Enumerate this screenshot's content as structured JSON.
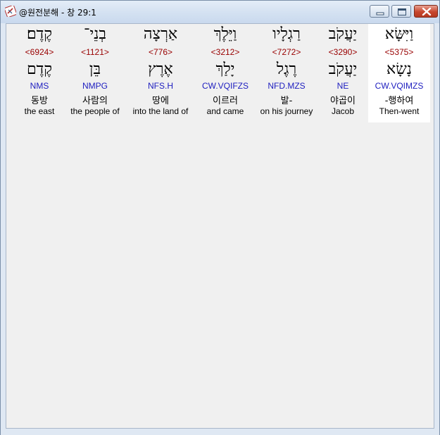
{
  "window": {
    "title": "@원전분해 - 창 29:1",
    "icon": "app-icon"
  },
  "words": [
    {
      "lemma_form": "וַיִּשָּׂא",
      "strong": "<5375>",
      "root": "נָשָׂא",
      "morph": "CW.VQIMZS",
      "korean": "-행하여",
      "english": "Then-went",
      "selected": true
    },
    {
      "lemma_form": "יַעֲקֹב",
      "strong": "<3290>",
      "root": "יַעֲקֹב",
      "morph": "NE",
      "korean": "야곱이",
      "english": "Jacob",
      "selected": false
    },
    {
      "lemma_form": "רַגְלָיו",
      "strong": "<7272>",
      "root": "רֶגֶל",
      "morph": "NFD.MZS",
      "korean": "발-",
      "english": "on his journey",
      "selected": false
    },
    {
      "lemma_form": "וַיֵּלֶךְ",
      "strong": "<3212>",
      "root": "יָלַךְ",
      "morph": "CW.VQIFZS",
      "korean": "이르러",
      "english": "and came",
      "selected": false
    },
    {
      "lemma_form": "אַרְצָה",
      "strong": "<776>",
      "root": "אֶרֶץ",
      "morph": "NFS.H",
      "korean": "땅에",
      "english": "into the land of",
      "selected": false
    },
    {
      "lemma_form": "בְנֵי־",
      "strong": "<1121>",
      "root": "בֵּן",
      "morph": "NMPG",
      "korean": "사람의",
      "english": "the people of",
      "selected": false
    },
    {
      "lemma_form": "קֶדֶם׃",
      "strong": "<6924>",
      "root": "קֶדֶם",
      "morph": "NMS",
      "korean": "동방",
      "english": "the east",
      "selected": false
    }
  ]
}
